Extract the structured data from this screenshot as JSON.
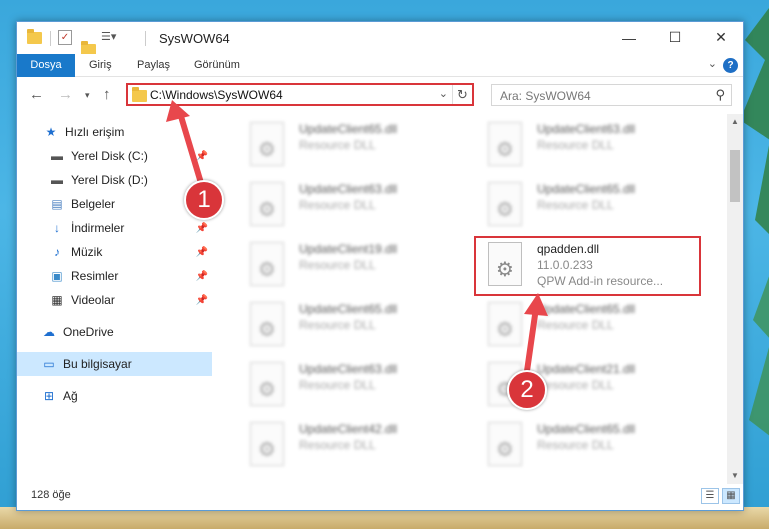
{
  "window": {
    "title": "SysWOW64",
    "minimize": "—",
    "maximize": "☐",
    "close": "✕"
  },
  "ribbon": {
    "tabs": [
      "Dosya",
      "Giriş",
      "Paylaş",
      "Görünüm"
    ],
    "expand_icon": "chevron-down-icon",
    "help": "?"
  },
  "address": {
    "path": "C:\\Windows\\SysWOW64",
    "search_placeholder": "Ara: SysWOW64"
  },
  "nav": {
    "quick_access": "Hızlı erişim",
    "items": [
      {
        "label": "Yerel Disk (C:)",
        "icon": "drive-icon",
        "pinned": true
      },
      {
        "label": "Yerel Disk (D:)",
        "icon": "drive-icon",
        "pinned": false
      },
      {
        "label": "Belgeler",
        "icon": "documents-icon",
        "pinned": true
      },
      {
        "label": "İndirmeler",
        "icon": "downloads-icon",
        "pinned": true
      },
      {
        "label": "Müzik",
        "icon": "music-icon",
        "pinned": true
      },
      {
        "label": "Resimler",
        "icon": "pictures-icon",
        "pinned": true
      },
      {
        "label": "Videolar",
        "icon": "videos-icon",
        "pinned": true
      }
    ],
    "onedrive": "OneDrive",
    "this_pc": "Bu bilgisayar",
    "network": "Ağ"
  },
  "files": [
    {
      "name": "UpdateClient65.dll",
      "type": "Resource DLL"
    },
    {
      "name": "UpdateClient63.dll",
      "type": "Resource DLL"
    },
    {
      "name": "UpdateClient63.dll",
      "type": "Resource DLL"
    },
    {
      "name": "UpdateClient65.dll",
      "type": "Resource DLL"
    },
    {
      "name": "UpdateClient19.dll",
      "type": "Resource DLL"
    },
    {
      "name": "qpadden.dll",
      "version": "11.0.0.233",
      "type": "QPW Add-in resource..."
    },
    {
      "name": "UpdateClient65.dll",
      "type": "Resource DLL"
    },
    {
      "name": "UpdateClient65.dll",
      "type": "Resource DLL"
    },
    {
      "name": "UpdateClient63.dll",
      "type": "Resource DLL"
    },
    {
      "name": "UpdateClient21.dll",
      "type": "Resource DLL"
    },
    {
      "name": "UpdateClient42.dll",
      "type": "Resource DLL"
    },
    {
      "name": "UpdateClient65.dll",
      "type": "Resource DLL"
    }
  ],
  "status": {
    "count": "128 öğe"
  },
  "callouts": [
    "1",
    "2"
  ],
  "colors": {
    "accent": "#1979ca",
    "highlight": "#d9353a",
    "selection": "#cce8ff"
  }
}
